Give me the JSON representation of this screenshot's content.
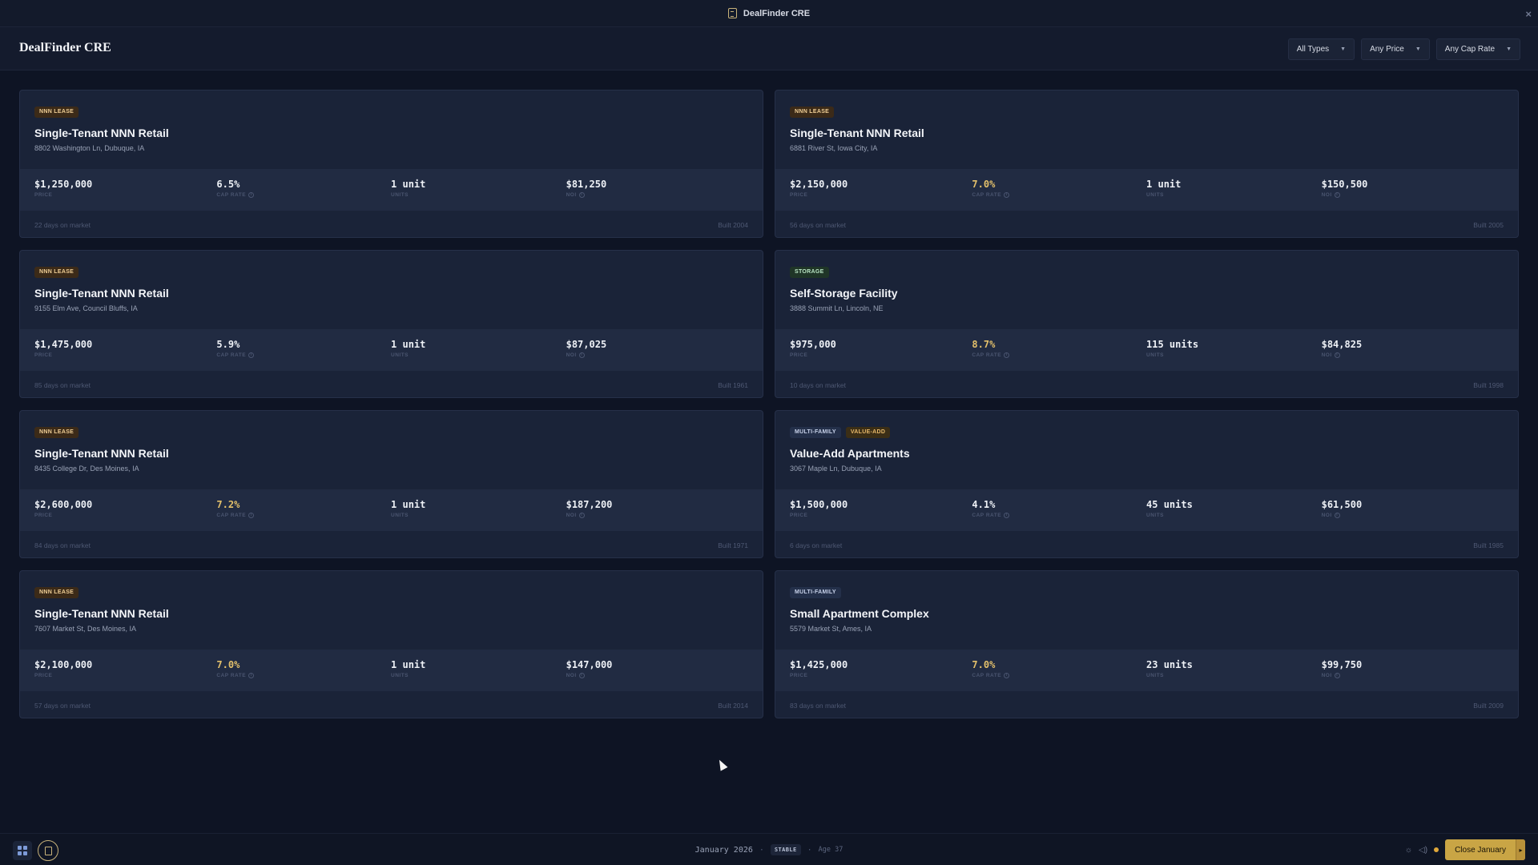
{
  "window": {
    "title": "DealFinder CRE"
  },
  "header": {
    "brand": "DealFinder CRE",
    "filters": [
      {
        "label": "All Types"
      },
      {
        "label": "Any Price"
      },
      {
        "label": "Any Cap Rate"
      }
    ]
  },
  "labels": {
    "price": "PRICE",
    "cap_rate": "CAP RATE",
    "units": "UNITS",
    "noi": "NOI"
  },
  "listings": [
    {
      "tags": [
        "NNN LEASE"
      ],
      "title": "Single-Tenant NNN Retail",
      "address": "8802 Washington Ln, Dubuque, IA",
      "price": "$1,250,000",
      "cap_rate": "6.5%",
      "units": "1 unit",
      "noi": "$81,250",
      "days": "22 days on market",
      "built": "Built 2004"
    },
    {
      "tags": [
        "NNN LEASE"
      ],
      "title": "Single-Tenant NNN Retail",
      "address": "6881 River St, Iowa City, IA",
      "price": "$2,150,000",
      "cap_rate": "7.0%",
      "units": "1 unit",
      "noi": "$150,500",
      "days": "56 days on market",
      "built": "Built 2005"
    },
    {
      "tags": [
        "NNN LEASE"
      ],
      "title": "Single-Tenant NNN Retail",
      "address": "9155 Elm Ave, Council Bluffs, IA",
      "price": "$1,475,000",
      "cap_rate": "5.9%",
      "units": "1 unit",
      "noi": "$87,025",
      "days": "85 days on market",
      "built": "Built 1961"
    },
    {
      "tags": [
        "STORAGE"
      ],
      "title": "Self-Storage Facility",
      "address": "3888 Summit Ln, Lincoln, NE",
      "price": "$975,000",
      "cap_rate": "8.7%",
      "units": "115 units",
      "noi": "$84,825",
      "days": "10 days on market",
      "built": "Built 1998"
    },
    {
      "tags": [
        "NNN LEASE"
      ],
      "title": "Single-Tenant NNN Retail",
      "address": "8435 College Dr, Des Moines, IA",
      "price": "$2,600,000",
      "cap_rate": "7.2%",
      "units": "1 unit",
      "noi": "$187,200",
      "days": "84 days on market",
      "built": "Built 1971"
    },
    {
      "tags": [
        "MULTI-FAMILY",
        "VALUE-ADD"
      ],
      "title": "Value-Add Apartments",
      "address": "3067 Maple Ln, Dubuque, IA",
      "price": "$1,500,000",
      "cap_rate": "4.1%",
      "units": "45 units",
      "noi": "$61,500",
      "days": "6 days on market",
      "built": "Built 1985"
    },
    {
      "tags": [
        "NNN LEASE"
      ],
      "title": "Single-Tenant NNN Retail",
      "address": "7607 Market St, Des Moines, IA",
      "price": "$2,100,000",
      "cap_rate": "7.0%",
      "units": "1 unit",
      "noi": "$147,000",
      "days": "57 days on market",
      "built": "Built 2014"
    },
    {
      "tags": [
        "MULTI-FAMILY"
      ],
      "title": "Small Apartment Complex",
      "address": "5579 Market St, Ames, IA",
      "price": "$1,425,000",
      "cap_rate": "7.0%",
      "units": "23 units",
      "noi": "$99,750",
      "days": "83 days on market",
      "built": "Built 2009"
    }
  ],
  "statusbar": {
    "month": "January 2026",
    "state": "STABLE",
    "age": "Age 37",
    "close_button": "Close January"
  },
  "colors": {
    "accent_gold": "#c9a545",
    "cap_rate_high": "#e3c06b"
  }
}
